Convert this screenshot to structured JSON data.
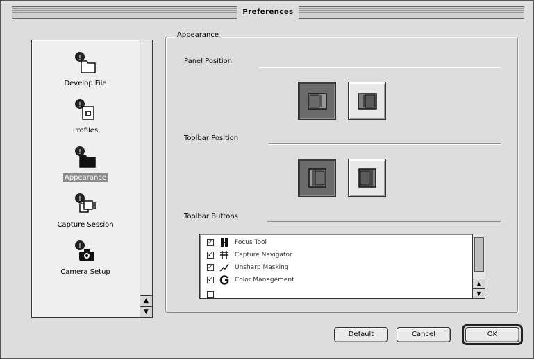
{
  "window": {
    "title": "Preferences"
  },
  "sidebar": {
    "items": [
      {
        "label": "Develop File",
        "icon": "folder-icon",
        "selected": false
      },
      {
        "label": "Profiles",
        "icon": "profile-document-icon",
        "selected": false
      },
      {
        "label": "Appearance",
        "icon": "appearance-folder-icon",
        "selected": true
      },
      {
        "label": "Capture Session",
        "icon": "capture-session-icon",
        "selected": false
      },
      {
        "label": "Camera Setup",
        "icon": "camera-icon",
        "selected": false
      }
    ]
  },
  "appearance": {
    "group_title": "Appearance",
    "panel_position": {
      "label": "Panel Position",
      "options": [
        {
          "icon": "panel-left-icon",
          "selected": true
        },
        {
          "icon": "panel-right-icon",
          "selected": false
        }
      ]
    },
    "toolbar_position": {
      "label": "Toolbar Position",
      "options": [
        {
          "icon": "toolbar-left-icon",
          "selected": true
        },
        {
          "icon": "toolbar-right-icon",
          "selected": false
        }
      ]
    },
    "toolbar_buttons": {
      "label": "Toolbar Buttons",
      "items": [
        {
          "label": "Focus Tool",
          "checked": true,
          "icon": "focus-tool-icon"
        },
        {
          "label": "Capture Navigator",
          "checked": true,
          "icon": "capture-navigator-icon"
        },
        {
          "label": "Unsharp Masking",
          "checked": true,
          "icon": "unsharp-masking-icon"
        },
        {
          "label": "Color Management",
          "checked": true,
          "icon": "color-management-icon"
        }
      ]
    }
  },
  "buttons": {
    "default": "Default",
    "cancel": "Cancel",
    "ok": "OK"
  },
  "colors": {
    "selected_option": "#6b6b6b",
    "selection_highlight": "#8a8a8a"
  }
}
